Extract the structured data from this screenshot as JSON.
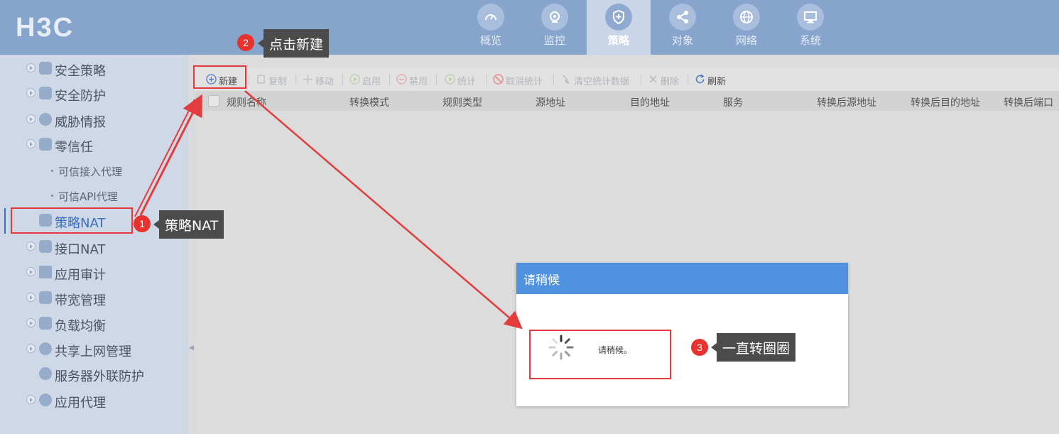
{
  "header": {
    "logo": "H3C",
    "nav": [
      {
        "label": "概览",
        "icon": "gauge-icon"
      },
      {
        "label": "监控",
        "icon": "camera-icon"
      },
      {
        "label": "策略",
        "icon": "shield-icon",
        "active": true
      },
      {
        "label": "对象",
        "icon": "share-icon"
      },
      {
        "label": "网络",
        "icon": "globe-icon"
      },
      {
        "label": "系统",
        "icon": "monitor-icon"
      }
    ]
  },
  "sidebar": {
    "items": [
      {
        "label": "安全策略"
      },
      {
        "label": "安全防护"
      },
      {
        "label": "威胁情报"
      },
      {
        "label": "零信任"
      },
      {
        "label": "可信接入代理"
      },
      {
        "label": "可信API代理"
      },
      {
        "label": "策略NAT"
      },
      {
        "label": "接口NAT"
      },
      {
        "label": "应用审计"
      },
      {
        "label": "带宽管理"
      },
      {
        "label": "负载均衡"
      },
      {
        "label": "共享上网管理"
      },
      {
        "label": "服务器外联防护"
      },
      {
        "label": "应用代理"
      }
    ]
  },
  "toolbar": {
    "buttons": [
      {
        "label": "新建"
      },
      {
        "label": "复制"
      },
      {
        "label": "移动"
      },
      {
        "label": "启用"
      },
      {
        "label": "禁用"
      },
      {
        "label": "统计"
      },
      {
        "label": "取消统计"
      },
      {
        "label": "清空统计数据"
      },
      {
        "label": "删除"
      },
      {
        "label": "刷新"
      }
    ]
  },
  "table": {
    "columns": [
      "规则名称",
      "转换模式",
      "规则类型",
      "源地址",
      "目的地址",
      "服务",
      "转换后源地址",
      "转换后目的地址",
      "转换后端口"
    ]
  },
  "dialog": {
    "title": "请稍候",
    "message": "请稍候。"
  },
  "annotations": [
    {
      "number": "1",
      "text": "策略NAT"
    },
    {
      "number": "2",
      "text": "点击新建"
    },
    {
      "number": "3",
      "text": "一直转圈圈"
    }
  ],
  "colors": {
    "header_bg": "#86a4cc",
    "sidebar_bg": "#cfd8e6",
    "dialog_title_bg": "#4f92e0",
    "annotation_red": "#e33c3c"
  }
}
